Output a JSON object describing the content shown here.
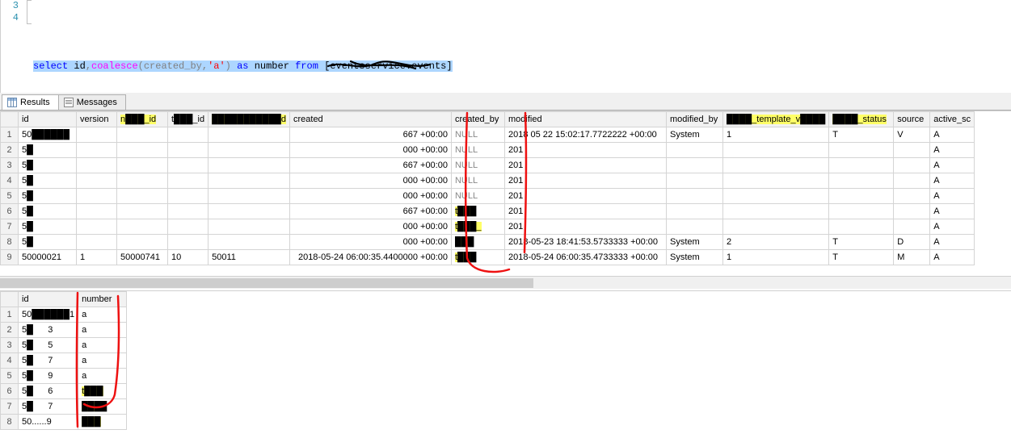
{
  "editor": {
    "line_numbers": [
      "3",
      "4"
    ],
    "sql_parts": {
      "select": "select",
      "cols1": " id",
      "comma": ",",
      "coalesce": "coalesce",
      "open": "(created_by,",
      "lit": "'a'",
      "close": ")",
      "as": " as ",
      "alias": "number",
      "from": " from ",
      "bracket_open": "[",
      "redacted": "█████████████████",
      "bracket_close": "]"
    }
  },
  "tabs": {
    "results": "Results",
    "messages": "Messages"
  },
  "grid1": {
    "headers": {
      "id": "id",
      "version": "version",
      "h3_redacted": "n███_id",
      "tour_id": "t███_id",
      "h5_redacted": "███████████d",
      "created": "created",
      "created_by": "created_by",
      "modified": "modified",
      "modified_by": "modified_by",
      "h10_redacted": "████_template_v████",
      "h11_redacted": "████_status",
      "source": "source",
      "active_sc": "active_sc"
    },
    "rows": [
      {
        "n": "1",
        "id": "50██████",
        "ver": "",
        "r1": "",
        "tour": "",
        "r2": "",
        "created": "667 +00:00",
        "cby": "NULL",
        "mod": "2018 05 22 15:02:17.7722222 +00:00",
        "mby": "System",
        "r3": "1",
        "r4": "T",
        "src": "V",
        "act": "A"
      },
      {
        "n": "2",
        "id": "5█",
        "ver": "",
        "r1": "",
        "tour": "",
        "r2": "",
        "created": "000 +00:00",
        "cby": "NULL",
        "mod": "201",
        "mby": "",
        "r3": "",
        "r4": "",
        "src": "",
        "act": "A"
      },
      {
        "n": "3",
        "id": "5█",
        "ver": "",
        "r1": "",
        "tour": "",
        "r2": "",
        "created": "667 +00:00",
        "cby": "NULL",
        "mod": "201",
        "mby": "",
        "r3": "",
        "r4": "",
        "src": "",
        "act": "A"
      },
      {
        "n": "4",
        "id": "5█",
        "ver": "",
        "r1": "",
        "tour": "",
        "r2": "",
        "created": "000 +00:00",
        "cby": "NULL",
        "mod": "201",
        "mby": "",
        "r3": "",
        "r4": "",
        "src": "",
        "act": "A"
      },
      {
        "n": "5",
        "id": "5█",
        "ver": "",
        "r1": "",
        "tour": "",
        "r2": "",
        "created": "000 +00:00",
        "cby": "NULL",
        "mod": "201",
        "mby": "",
        "r3": "",
        "r4": "",
        "src": "",
        "act": "A"
      },
      {
        "n": "6",
        "id": "5█",
        "ver": "",
        "r1": "",
        "tour": "",
        "r2": "",
        "created": "667 +00:00",
        "cby": "t███",
        "mod": "201",
        "mby": "",
        "r3": "",
        "r4": "",
        "src": "",
        "act": "A",
        "cby_hl": true
      },
      {
        "n": "7",
        "id": "5█",
        "ver": "",
        "r1": "",
        "tour": "",
        "r2": "",
        "created": "000 +00:00",
        "cby": "t███_",
        "mod": "201",
        "mby": "",
        "r3": "",
        "r4": "",
        "src": "",
        "act": "A",
        "cby_hl": true
      },
      {
        "n": "8",
        "id": "5█",
        "ver": "",
        "r1": "",
        "tour": "",
        "r2": "",
        "created": "000 +00:00",
        "cby": "███",
        "mod": "2018-05-23 18:41:53.5733333 +00:00",
        "mby": "System",
        "r3": "2",
        "r4": "T",
        "src": "D",
        "act": "A",
        "cby_hl": true
      },
      {
        "n": "9",
        "id": "50000021",
        "ver": "1",
        "r1": "50000741",
        "tour": "10",
        "r2": "50011",
        "created": "2018-05-24 06:00:35.4400000 +00:00",
        "cby": "t███",
        "mod": "2018-05-24 06:00:35.4733333 +00:00",
        "mby": "System",
        "r3": "1",
        "r4": "T",
        "src": "M",
        "act": "A",
        "cby_hl": true
      }
    ]
  },
  "grid2": {
    "headers": {
      "id": "id",
      "number": "number"
    },
    "rows": [
      {
        "n": "1",
        "id": "50██████1",
        "num": "a"
      },
      {
        "n": "2",
        "id": "5█      3",
        "num": "a"
      },
      {
        "n": "3",
        "id": "5█      5",
        "num": "a"
      },
      {
        "n": "4",
        "id": "5█      7",
        "num": "a"
      },
      {
        "n": "5",
        "id": "5█      9",
        "num": "a"
      },
      {
        "n": "6",
        "id": "5█      6",
        "num": "t███",
        "hl": true
      },
      {
        "n": "7",
        "id": "5█      7",
        "num": "████",
        "hl": true
      },
      {
        "n": "8",
        "id": "50......9",
        "num": "███",
        "hl": true
      }
    ]
  }
}
